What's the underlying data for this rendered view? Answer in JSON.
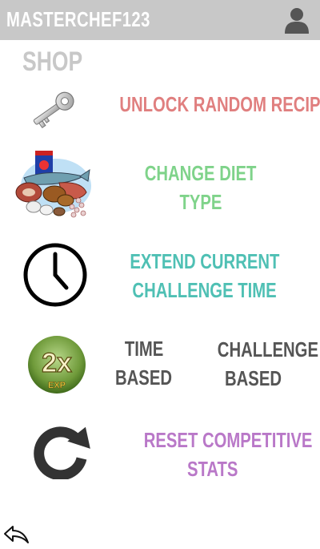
{
  "header": {
    "username": "MASTERCHEF123",
    "profile_icon": "user-silhouette-icon",
    "background": "#c8c8c8"
  },
  "shop": {
    "title": "SHOP",
    "items": [
      {
        "id": "unlock-recipe",
        "icon": "key-icon",
        "lines": [
          "UNLOCK RANDOM RECIPE"
        ],
        "color": "#e07f7f"
      },
      {
        "id": "change-diet",
        "icon": "food-pile-icon",
        "lines": [
          "CHANGE DIET",
          "TYPE"
        ],
        "color": "#7fd38a"
      },
      {
        "id": "extend-time",
        "icon": "clock-icon",
        "lines": [
          "EXTEND CURRENT",
          "CHALLENGE TIME"
        ],
        "color": "#4fc0b4"
      },
      {
        "id": "double-exp",
        "icon": "2x-exp-badge-icon",
        "badge_main": "2x",
        "badge_sub": "EXP",
        "options": [
          {
            "lines": [
              "TIME",
              "BASED"
            ],
            "color": "#555555"
          },
          {
            "lines": [
              "CHALLENGE",
              "BASED"
            ],
            "color": "#555555"
          }
        ]
      },
      {
        "id": "reset-stats",
        "icon": "refresh-icon",
        "lines": [
          "RESET COMPETITIVE",
          "STATS"
        ],
        "color": "#b978c8"
      }
    ]
  },
  "footer": {
    "back_icon": "back-arrow-icon"
  }
}
